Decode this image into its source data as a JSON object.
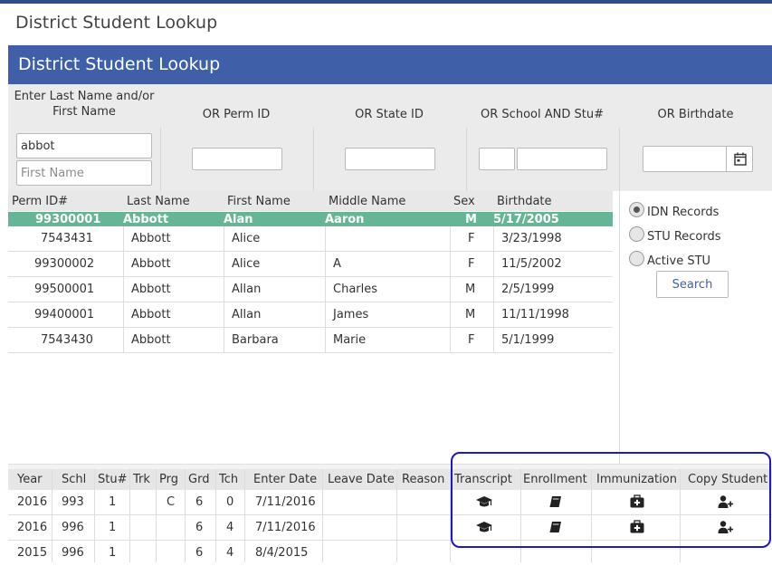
{
  "page_title": "District Student Lookup",
  "banner_title": "District Student Lookup",
  "filters": {
    "name_label_line1": "Enter Last Name and/or",
    "name_label_line2": "First Name",
    "perm_label": "OR Perm ID",
    "state_label": "OR State ID",
    "school_label": "OR School AND Stu#",
    "birthdate_label": "OR Birthdate",
    "last_name_value": "abbot",
    "first_name_placeholder": "First Name"
  },
  "results": {
    "columns": [
      "Perm ID#",
      "Last Name",
      "First Name",
      "Middle Name",
      "Sex",
      "Birthdate"
    ],
    "rows": [
      {
        "perm": "99300001",
        "last": "Abbott",
        "first": "Alan",
        "middle": "Aaron",
        "sex": "M",
        "birth": "5/17/2005"
      },
      {
        "perm": "7543431",
        "last": "Abbott",
        "first": "Alice",
        "middle": "",
        "sex": "F",
        "birth": "3/23/1998"
      },
      {
        "perm": "99300002",
        "last": "Abbott",
        "first": "Alice",
        "middle": "A",
        "sex": "F",
        "birth": "11/5/2002"
      },
      {
        "perm": "99500001",
        "last": "Abbott",
        "first": "Allan",
        "middle": "Charles",
        "sex": "M",
        "birth": "2/5/1999"
      },
      {
        "perm": "99400001",
        "last": "Abbott",
        "first": "Allan",
        "middle": "James",
        "sex": "M",
        "birth": "11/11/1998"
      },
      {
        "perm": "7543430",
        "last": "Abbott",
        "first": "Barbara",
        "middle": "Marie",
        "sex": "F",
        "birth": "5/1/1999"
      }
    ]
  },
  "options": {
    "idn": "IDN Records",
    "stu": "STU Records",
    "active": "Active STU",
    "selected": "IDN Records",
    "search_label": "Search"
  },
  "enrollment": {
    "columns": [
      "Year",
      "Schl",
      "Stu#",
      "Trk",
      "Prg",
      "Grd",
      "Tch",
      "Enter Date",
      "Leave Date",
      "Reason",
      "Transcript",
      "Enrollment",
      "Immunization",
      "Copy Student"
    ],
    "rows": [
      {
        "year": "2016",
        "schl": "993",
        "stu": "1",
        "trk": "",
        "prg": "C",
        "grd": "6",
        "tch": "0",
        "enter": "7/11/2016",
        "leave": "",
        "reason": ""
      },
      {
        "year": "2016",
        "schl": "996",
        "stu": "1",
        "trk": "",
        "prg": "",
        "grd": "6",
        "tch": "4",
        "enter": "7/11/2016",
        "leave": "",
        "reason": ""
      },
      {
        "year": "2015",
        "schl": "996",
        "stu": "1",
        "trk": "",
        "prg": "",
        "grd": "6",
        "tch": "4",
        "enter": "8/4/2015",
        "leave": "",
        "reason": ""
      }
    ]
  },
  "icons": {
    "transcript": "graduation-cap-icon",
    "enrollment": "book-icon",
    "immunization": "medkit-icon",
    "copy": "user-plus-icon",
    "calendar": "calendar-icon"
  },
  "colors": {
    "banner": "#3f5fa8",
    "selected_row": "#66b596",
    "highlight_outline": "#1a1ac8"
  }
}
